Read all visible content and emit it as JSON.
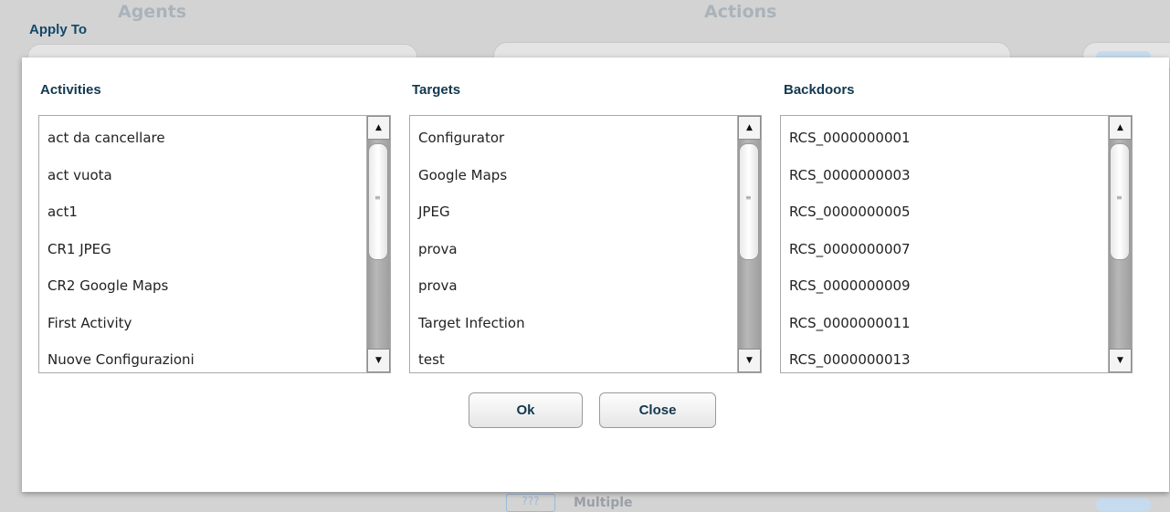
{
  "background": {
    "agents_label": "Agents",
    "actions_label": "Actions",
    "bottom_button_label": "???",
    "bottom_text": "Multiple"
  },
  "dialog": {
    "title": "Apply To",
    "ok_label": "Ok",
    "close_label": "Close"
  },
  "columns": [
    {
      "title": "Activities",
      "items": [
        "act da cancellare",
        "act vuota",
        "act1",
        "CR1 JPEG",
        "CR2 Google Maps",
        "First Activity",
        "Nuove Configurazioni"
      ]
    },
    {
      "title": "Targets",
      "items": [
        "Configurator",
        "Google Maps",
        "JPEG",
        "prova",
        "prova",
        "Target Infection",
        "test"
      ]
    },
    {
      "title": "Backdoors",
      "items": [
        "RCS_0000000001",
        "RCS_0000000003",
        "RCS_0000000005",
        "RCS_0000000007",
        "RCS_0000000009",
        "RCS_0000000011",
        "RCS_0000000013"
      ]
    }
  ],
  "icons": {
    "scroll_up": "▲",
    "scroll_down": "▼",
    "grip": "≡"
  }
}
